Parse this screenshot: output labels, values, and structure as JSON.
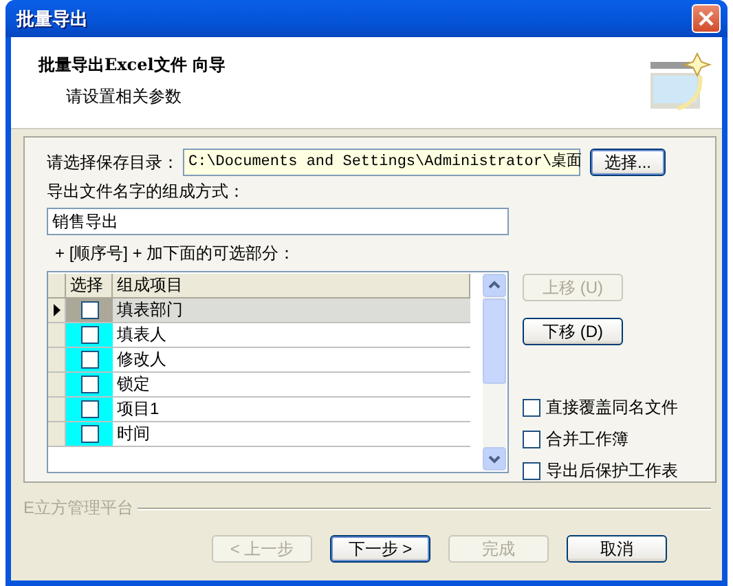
{
  "window": {
    "title": "批量导出"
  },
  "header": {
    "title": "批量导出Excel文件 向导",
    "subtitle": "请设置相关参数"
  },
  "directory": {
    "label": "请选择保存目录：",
    "value": "C:\\Documents and Settings\\Administrator\\桌面",
    "button": "选择..."
  },
  "filename": {
    "label": "导出文件名字的组成方式：",
    "value": "销售导出"
  },
  "parts_label": "+ [顺序号] + 加下面的可选部分：",
  "grid": {
    "columns": [
      "选择",
      "组成项目"
    ],
    "rows": [
      {
        "label": "填表部门",
        "checked": false,
        "selected": true
      },
      {
        "label": "填表人",
        "checked": false,
        "selected": false
      },
      {
        "label": "修改人",
        "checked": false,
        "selected": false
      },
      {
        "label": "锁定",
        "checked": false,
        "selected": false
      },
      {
        "label": "项目1",
        "checked": false,
        "selected": false
      },
      {
        "label": "时间",
        "checked": false,
        "selected": false
      }
    ]
  },
  "move_buttons": [
    {
      "label": "上移 (U)",
      "disabled": true
    },
    {
      "label": "下移 (D)",
      "disabled": false
    }
  ],
  "options": [
    {
      "label": "直接覆盖同名文件",
      "checked": false
    },
    {
      "label": "合并工作簿",
      "checked": false
    },
    {
      "label": "导出后保护工作表",
      "checked": false
    }
  ],
  "brand": "E立方管理平台",
  "nav_buttons": [
    {
      "label": "< 上一步",
      "disabled": true,
      "default": false
    },
    {
      "label": "下一步 >",
      "disabled": false,
      "default": true
    },
    {
      "label": "完成",
      "disabled": true,
      "default": false
    },
    {
      "label": "取消",
      "disabled": false,
      "default": false
    }
  ]
}
